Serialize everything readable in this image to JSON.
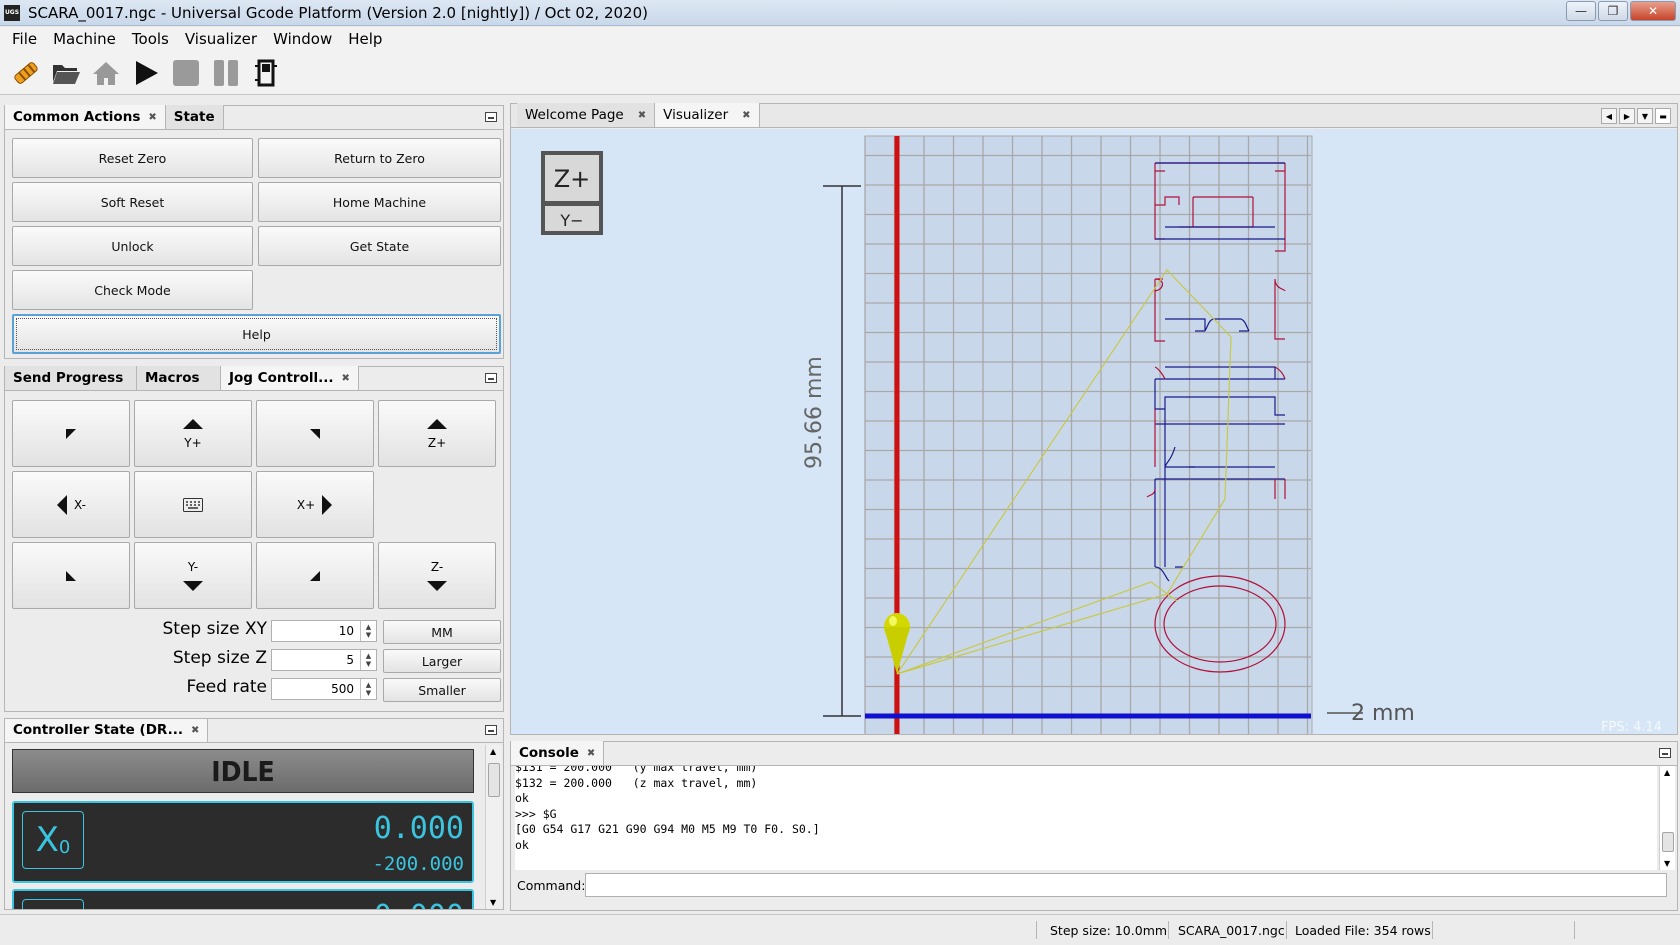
{
  "window": {
    "title": "SCARA_0017.ngc - Universal Gcode Platform (Version 2.0 [nightly]) / Oct 02, 2020)",
    "logo_text": "UGS"
  },
  "menu": [
    "File",
    "Machine",
    "Tools",
    "Visualizer",
    "Window",
    "Help"
  ],
  "toolbar_icons": [
    "connect-icon",
    "open-folder-icon",
    "home-icon",
    "play-icon",
    "stop-icon",
    "pause-icon",
    "outline-icon"
  ],
  "common_actions": {
    "tabs": [
      "Common Actions",
      "State"
    ],
    "buttons": {
      "reset_zero": "Reset Zero",
      "return_to_zero": "Return to Zero",
      "soft_reset": "Soft Reset",
      "home_machine": "Home Machine",
      "unlock": "Unlock",
      "get_state": "Get State",
      "check_mode": "Check Mode",
      "help": "Help"
    }
  },
  "jog_panel": {
    "tabs": [
      "Send Progress",
      "Macros",
      "Jog Controll..."
    ],
    "labels": {
      "y_plus": "Y+",
      "z_plus": "Z+",
      "x_minus": "X-",
      "x_plus": "X+",
      "y_minus": "Y-",
      "z_minus": "Z-"
    },
    "step_xy_label": "Step size XY",
    "step_xy_value": "10",
    "step_z_label": "Step size Z",
    "step_z_value": "5",
    "feed_label": "Feed rate",
    "feed_value": "500",
    "unit_button": "MM",
    "larger_button": "Larger",
    "smaller_button": "Smaller"
  },
  "controller_state": {
    "tab": "Controller State (DR...",
    "state": "IDLE",
    "x_axis": "X",
    "x_sub": "0",
    "x_work": "0.000",
    "x_machine": "-200.000",
    "y_work": "0.000"
  },
  "editor_tabs": [
    "Welcome Page",
    "Visualizer"
  ],
  "visualizer": {
    "view_z": "Z+",
    "view_y": "Y−",
    "dim_label": "95.66 mm",
    "scale_label": "2 mm",
    "fps": "FPS: 4.14",
    "colors": {
      "x_axis": "#d01010",
      "y_axis": "#1010d0",
      "grid": "#a8a8a8",
      "path": "#d0d050"
    }
  },
  "console": {
    "tab": "Console",
    "lines": [
      "$131 = 200.000   (y max travel, mm)",
      "$132 = 200.000   (z max travel, mm)",
      "ok",
      ">>> $G",
      "[G0 G54 G17 G21 G90 G94 M0 M5 M9 T0 F0. S0.]",
      "ok"
    ],
    "command_label": "Command:"
  },
  "statusbar": {
    "step_size": "Step size: 10.0mm",
    "file": "SCARA_0017.ngc",
    "loaded": "Loaded File: 354 rows"
  }
}
